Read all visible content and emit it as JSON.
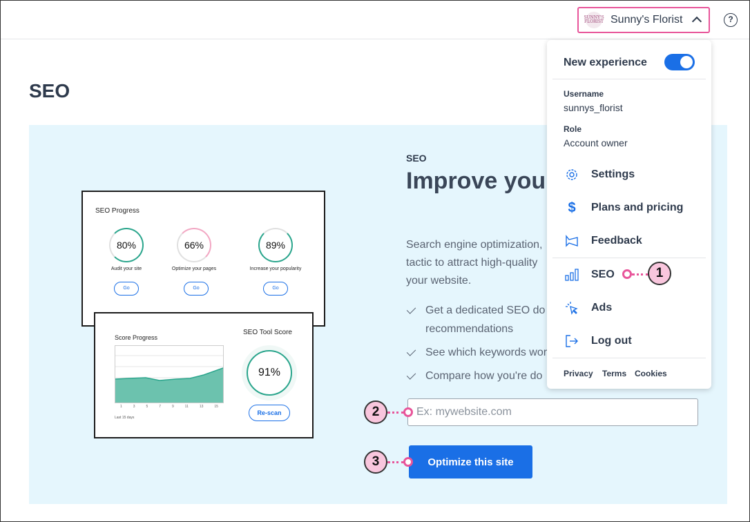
{
  "topbar": {
    "account_logo_text": "SUNNY'S FLORIST",
    "account_name": "Sunny's Florist",
    "help_label": "?"
  },
  "page": {
    "title": "SEO"
  },
  "illustration": {
    "card1_title": "SEO Progress",
    "rings": [
      {
        "value": "80%",
        "label": "Audit your site",
        "button": "Go",
        "color": "#2aa58c"
      },
      {
        "value": "66%",
        "label": "Optimize your pages",
        "button": "Go",
        "color": "#f2a7c3"
      },
      {
        "value": "89%",
        "label": "Increase your popularity",
        "button": "Go",
        "color": "#2aa58c"
      }
    ],
    "card2_title": "Score Progress",
    "chart_caption": "Last 15 days",
    "chart_ticks": [
      "1",
      "3",
      "5",
      "7",
      "9",
      "11",
      "13",
      "15"
    ],
    "score_title": "SEO Tool Score",
    "score_value": "91%",
    "rescan_label": "Re-scan"
  },
  "hero": {
    "kicker": "SEO",
    "headline": "Improve your visibility",
    "description": "Search engine optimization, tactic to attract high-quality your website.",
    "checks": [
      "Get a dedicated SEO do recommendations",
      "See which keywords wor",
      "Compare how you're do"
    ],
    "url_placeholder": "Ex: mywebsite.com",
    "optimize_label": "Optimize this site"
  },
  "menu": {
    "new_experience_label": "New experience",
    "new_experience_on": true,
    "username_label": "Username",
    "username_value": "sunnys_florist",
    "role_label": "Role",
    "role_value": "Account owner",
    "items": [
      {
        "label": "Settings",
        "icon": "gear-icon"
      },
      {
        "label": "Plans and pricing",
        "icon": "dollar-icon"
      },
      {
        "label": "Feedback",
        "icon": "megaphone-icon"
      },
      {
        "label": "SEO",
        "icon": "bar-chart-icon"
      },
      {
        "label": "Ads",
        "icon": "cursor-click-icon"
      },
      {
        "label": "Log out",
        "icon": "logout-icon"
      }
    ],
    "footer": [
      "Privacy",
      "Terms",
      "Cookies"
    ]
  },
  "callouts": [
    "1",
    "2",
    "3"
  ],
  "colors": {
    "accent_blue": "#1a6fe6",
    "callout_pink": "#e8559a",
    "hero_bg": "#e5f6fd"
  }
}
